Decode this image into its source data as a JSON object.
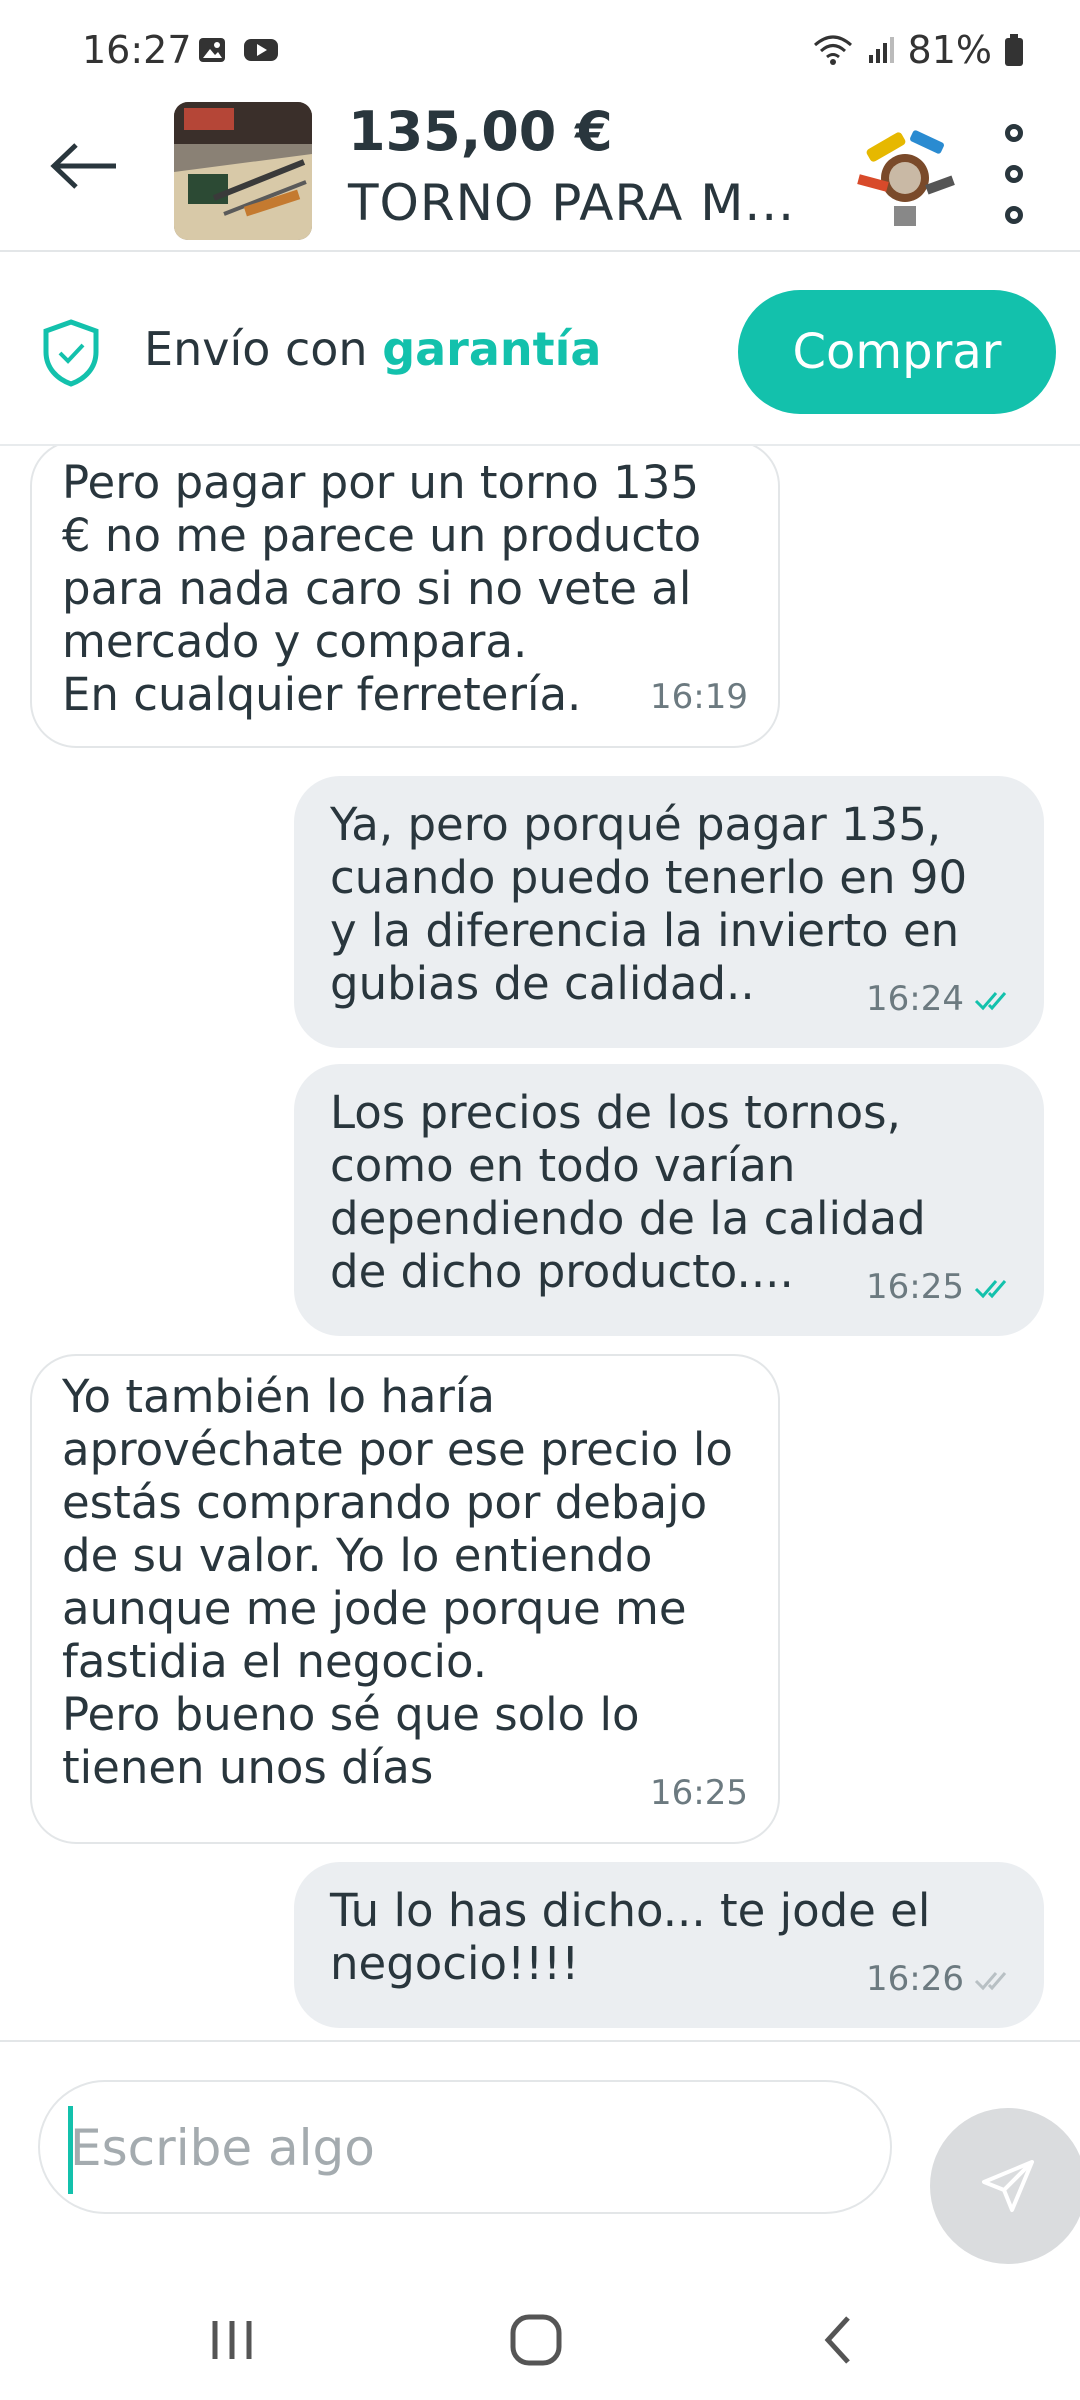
{
  "status_bar": {
    "time": "16:27",
    "battery": "81%",
    "icons": [
      "image-icon",
      "youtube-icon",
      "wifi-icon",
      "signal-icon",
      "battery-icon"
    ]
  },
  "header": {
    "price": "135,00 €",
    "title": "TORNO PARA M..."
  },
  "guarantee": {
    "text_prefix": "Envío con ",
    "text_strong": "garantía",
    "buy_label": "Comprar"
  },
  "messages": [
    {
      "direction": "in",
      "text": "Pero pagar por un torno 135\n€ no me parece un producto\npara nada caro si no vete al\nmercado y compara.\nEn cualquier ferretería.",
      "time": "16:19"
    },
    {
      "direction": "out",
      "text": "Ya, pero porqué pagar 135,\ncuando puedo tenerlo en 90\ny la diferencia la invierto en\ngubias de calidad..",
      "time": "16:24",
      "status": "read"
    },
    {
      "direction": "out",
      "text": "Los precios de los tornos,\ncomo en todo varían\ndependiendo de la calidad\nde dicho producto....",
      "time": "16:25",
      "status": "read"
    },
    {
      "direction": "in",
      "text": "Yo también lo haría\naprovéchate por ese precio lo\nestás comprando por debajo\nde su valor. Yo lo entiendo\naunque me jode porque me\nfastidia el negocio.\nPero bueno sé que solo lo\ntienen unos días",
      "time": "16:25"
    },
    {
      "direction": "out",
      "text": "Tu lo has dicho... te jode el\nnegocio!!!!",
      "time": "16:26",
      "status": "delivered"
    }
  ],
  "composer": {
    "placeholder": "Escribe algo"
  },
  "colors": {
    "accent": "#13c1ac",
    "text": "#29363d",
    "outgoing_bubble": "#ebeef1",
    "read_check": "#13c1ac",
    "delivered_check": "#b8c0c4"
  }
}
